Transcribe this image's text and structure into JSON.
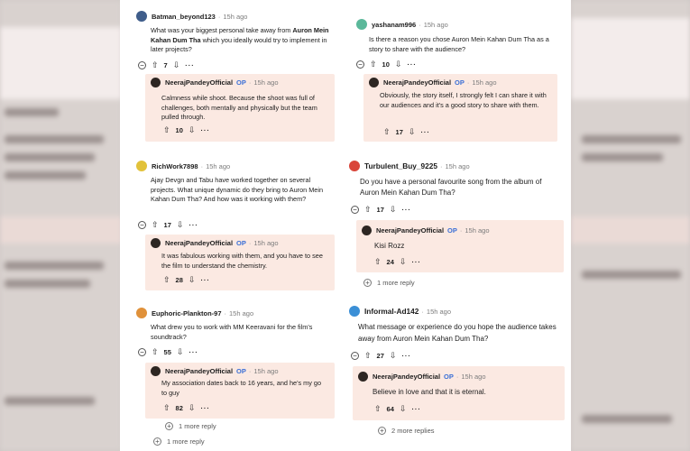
{
  "common": {
    "op_name": "NeerajPandeyOfficial",
    "op_badge": "OP",
    "time": "15h ago",
    "dot": "·",
    "more": "···",
    "up": "⇧",
    "down": "⇩",
    "collapse": "−",
    "plus": "+"
  },
  "threads": [
    {
      "user": "Batman_beyond123",
      "avatar_color": "#3f5d8a",
      "question_pre": "What was your biggest personal take away from ",
      "question_bold": "Auron Mein Kahan Dum Tha",
      "question_post": " which you ideally would try to implement in later projects?",
      "votes": "7",
      "reply": "Calmness while shoot. Because the shoot was full of challenges, both mentally and physically but the team pulled through.",
      "reply_votes": "10"
    },
    {
      "user": "yashanam996",
      "avatar_color": "#5bb89a",
      "question": "Is there a reason you chose Auron Mein Kahan Dum Tha as a story to share with the audience?",
      "votes": "10",
      "reply": "Obviously, the story itself, I strongly felt I can share it with our audiences and it's a good story to share with them.",
      "reply_votes": "17"
    },
    {
      "user": "RichWork7898",
      "avatar_color": "#e2c23a",
      "question": "Ajay Devgn and Tabu have worked together on several projects. What unique dynamic do they bring to Auron Mein Kahan Dum Tha? And how was it working with them?",
      "votes": "17",
      "reply": "It was fabulous working with them, and you have to see the film to understand the chemistry.",
      "reply_votes": "28"
    },
    {
      "user": "Turbulent_Buy_9225",
      "avatar_color": "#d9453a",
      "question": "Do you have a personal favourite song from the album of Auron Mein Kahan Dum Tha?",
      "votes": "17",
      "reply": "Kisi Rozz",
      "reply_votes": "24",
      "more_replies": "1 more reply"
    },
    {
      "user": "Euphoric-Plankton-97",
      "avatar_color": "#e0913a",
      "question": "What drew you to work with MM Keeravani for the film's soundtrack?",
      "votes": "55",
      "reply": "My association dates back to 16 years, and he's my go to guy",
      "reply_votes": "82",
      "more_replies": "1 more reply",
      "more_replies_2": "1 more reply"
    },
    {
      "user": "Informal-Ad142",
      "avatar_color": "#3b8fd6",
      "question": "What message or experience do you hope the audience takes away from Auron Mein Kahan Dum Tha?",
      "votes": "27",
      "reply": "Believe in love and that it is eternal.",
      "reply_votes": "64",
      "more_replies": "2 more replies"
    }
  ]
}
